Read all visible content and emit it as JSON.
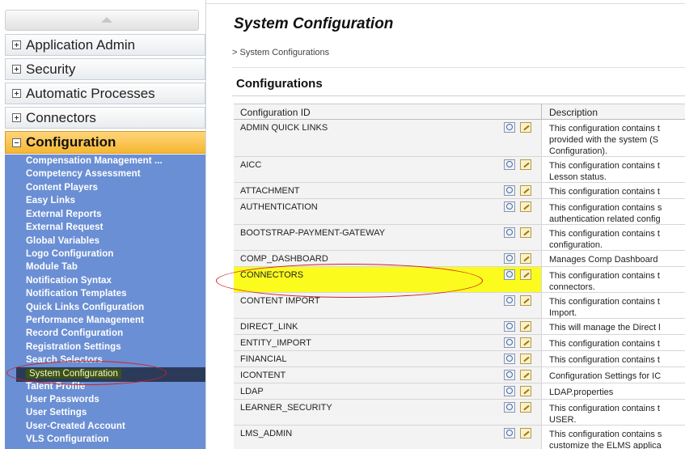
{
  "sidebar": {
    "nav": [
      {
        "label": "Application Admin",
        "expanded": false
      },
      {
        "label": "Security",
        "expanded": false
      },
      {
        "label": "Automatic Processes",
        "expanded": false
      },
      {
        "label": "Connectors",
        "expanded": false
      }
    ],
    "active": {
      "label": "Configuration",
      "expanded": true
    },
    "submenu": [
      "Compensation Management ...",
      "Competency Assessment",
      "Content Players",
      "Easy Links",
      "External Reports",
      "External Request",
      "Global Variables",
      "Logo Configuration",
      "Module Tab",
      "Notification Syntax",
      "Notification Templates",
      "Quick Links Configuration",
      "Performance Management",
      "Record Configuration",
      "Registration Settings",
      "Search Selectors",
      "System Configuration",
      "Talent Profile",
      "User Passwords",
      "User Settings",
      "User-Created Account",
      "VLS Configuration"
    ],
    "selected_index": 16
  },
  "main": {
    "title": "System Configuration",
    "breadcrumb": "> System Configurations",
    "section_title": "Configurations",
    "columns": {
      "id": "Configuration ID",
      "desc": "Description"
    },
    "rows": [
      {
        "id": "ADMIN QUICK LINKS",
        "desc": "This configuration contains t\nprovided with the system (S\nConfiguration)."
      },
      {
        "id": "AICC",
        "desc": "This configuration contains t\nLesson status."
      },
      {
        "id": "ATTACHMENT",
        "desc": "This configuration contains t"
      },
      {
        "id": "AUTHENTICATION",
        "desc": "This configuration contains s\nauthentication related config"
      },
      {
        "id": "BOOTSTRAP-PAYMENT-GATEWAY",
        "desc": "This configuration contains t\nconfiguration."
      },
      {
        "id": "COMP_DASHBOARD",
        "desc": "Manages Comp Dashboard"
      },
      {
        "id": "CONNECTORS",
        "desc": "This configuration contains t\nconnectors.",
        "highlighted": true
      },
      {
        "id": "CONTENT IMPORT",
        "desc": "This configuration contains t\nImport."
      },
      {
        "id": "DIRECT_LINK",
        "desc": "This will manage the Direct l"
      },
      {
        "id": "ENTITY_IMPORT",
        "desc": "This configuration contains t"
      },
      {
        "id": "FINANCIAL",
        "desc": "This configuration contains t"
      },
      {
        "id": "ICONTENT",
        "desc": "Configuration Settings for IC"
      },
      {
        "id": "LDAP",
        "desc": "LDAP.properties"
      },
      {
        "id": "LEARNER_SECURITY",
        "desc": "This configuration contains t\nUSER."
      },
      {
        "id": "LMS_ADMIN",
        "desc": "This configuration contains s\ncustomize the ELMS applica"
      }
    ]
  },
  "colors": {
    "active_nav": "#f5b731",
    "submenu_bg": "#6b8fd4",
    "highlight": "#fbfb1e",
    "annotation": "#d02020"
  },
  "icons": {
    "row_actions": [
      "view-icon",
      "edit-icon"
    ],
    "expand": "plus-icon",
    "collapse": "minus-icon"
  }
}
